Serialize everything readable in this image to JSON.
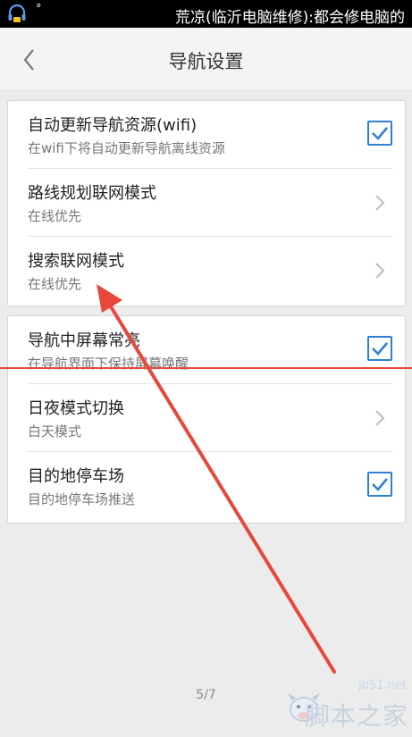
{
  "statusbar": {
    "dot": "°",
    "marquee": "荒凉(临沂电脑维修):都会修电脑的"
  },
  "header": {
    "title": "导航设置"
  },
  "section1": {
    "items": [
      {
        "label": "自动更新导航资源(wifi)",
        "sub": "在wifi下将自动更新导航离线资源",
        "control": "checkbox",
        "checked": true
      },
      {
        "label": "路线规划联网模式",
        "sub": "在线优先",
        "control": "chevron"
      },
      {
        "label": "搜索联网模式",
        "sub": "在线优先",
        "control": "chevron"
      }
    ]
  },
  "section2": {
    "items": [
      {
        "label": "导航中屏幕常亮",
        "sub": "在导航界面下保持屏幕唤醒",
        "control": "checkbox",
        "checked": true
      },
      {
        "label": "日夜模式切换",
        "sub": "白天模式",
        "control": "chevron"
      },
      {
        "label": "目的地停车场",
        "sub": "目的地停车场推送",
        "control": "checkbox",
        "checked": true
      }
    ]
  },
  "pager": "5/7",
  "watermark": {
    "url": "jb51.net",
    "text": "脚本之家"
  },
  "colors": {
    "accent": "#2f7fd8",
    "annotation": "#e8483c"
  }
}
